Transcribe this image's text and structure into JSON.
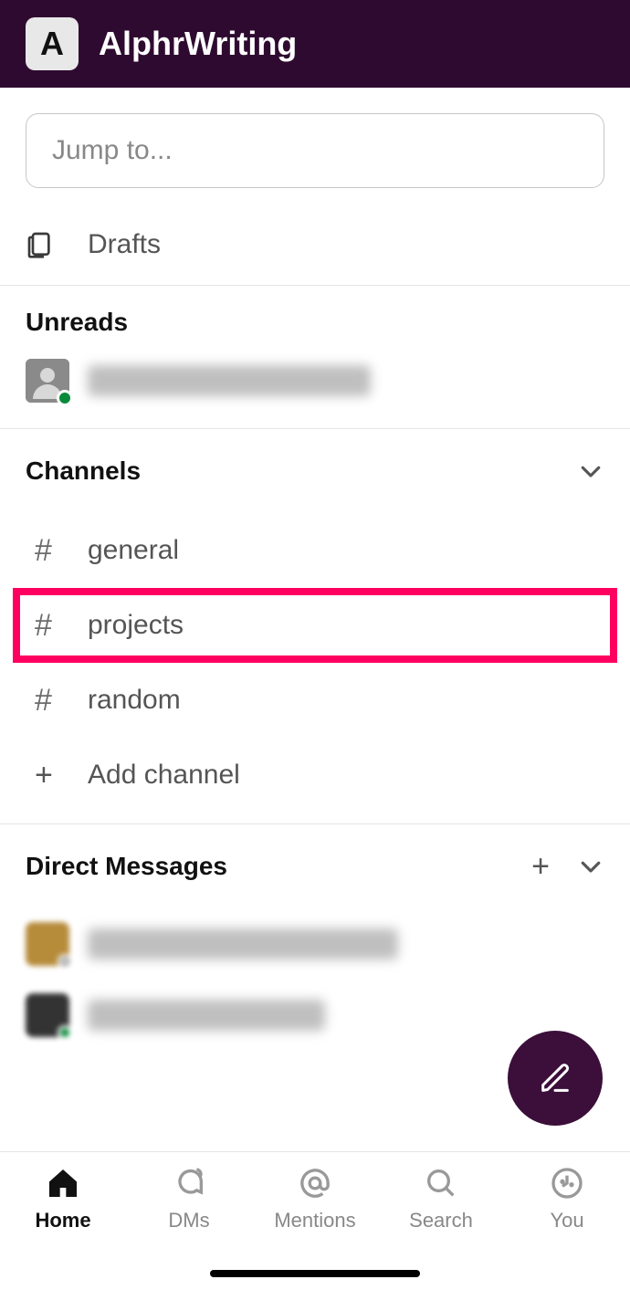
{
  "header": {
    "workspace_initial": "A",
    "workspace_name": "AlphrWriting"
  },
  "search": {
    "placeholder": "Jump to..."
  },
  "drafts": {
    "label": "Drafts"
  },
  "unreads": {
    "title": "Unreads"
  },
  "channels": {
    "title": "Channels",
    "items": [
      {
        "name": "general",
        "highlight": false
      },
      {
        "name": "projects",
        "highlight": true
      },
      {
        "name": "random",
        "highlight": false
      }
    ],
    "add_label": "Add channel"
  },
  "dms": {
    "title": "Direct Messages"
  },
  "tabs": {
    "home": "Home",
    "dms": "DMs",
    "mentions": "Mentions",
    "search": "Search",
    "you": "You"
  }
}
